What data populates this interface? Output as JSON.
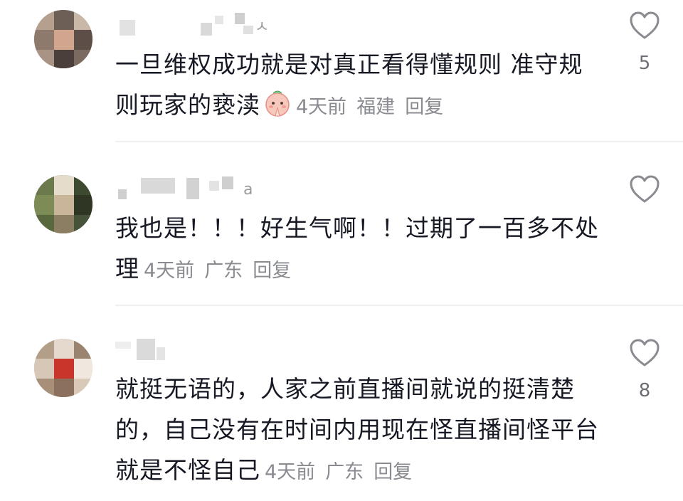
{
  "comments": [
    {
      "text": "一旦维权成功就是对真正看得懂规则 准守规则玩家的亵渎",
      "time": "4天前",
      "location": "福建",
      "reply": "回复",
      "likes": "5",
      "has_emoji": true
    },
    {
      "text": "我也是！！！好生气啊！！过期了一百多不处理",
      "time": "4天前",
      "location": "广东",
      "reply": "回复",
      "likes": ""
    },
    {
      "text": "就挺无语的，人家之前直播间就说的挺清楚的，自己没有在时间内用现在怪直播间怪平台就是不怪自己",
      "time": "4天前",
      "location": "广东",
      "reply": "回复",
      "likes": "8"
    }
  ],
  "icons": {
    "like": "heart-outline-icon",
    "emoji": "praying-face-emoji"
  },
  "colors": {
    "text": "#161823",
    "meta": "#8a8b91",
    "divider": "#efefef"
  }
}
